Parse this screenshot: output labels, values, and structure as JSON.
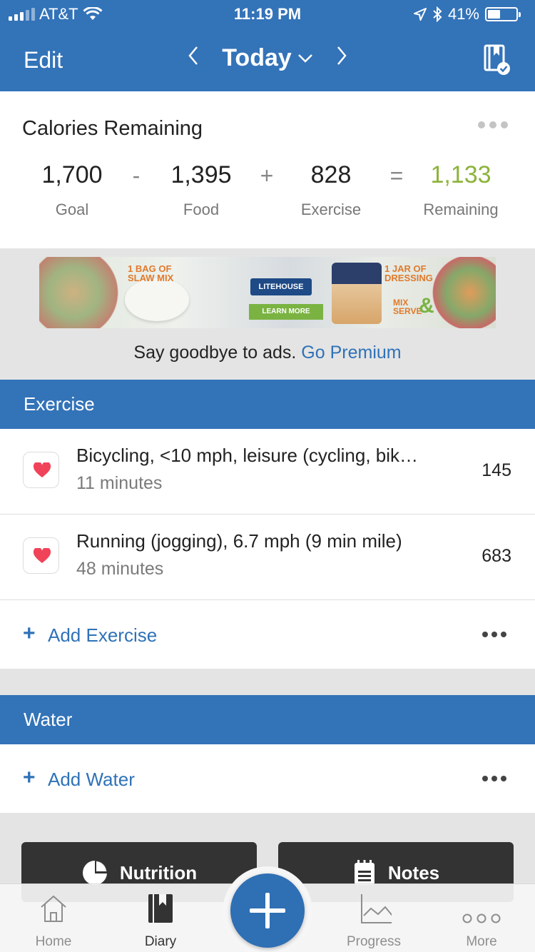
{
  "status_bar": {
    "carrier": "AT&T",
    "time": "11:19 PM",
    "battery": "41%"
  },
  "nav": {
    "edit": "Edit",
    "title": "Today",
    "prev": "<",
    "next": ">"
  },
  "calories": {
    "title": "Calories Remaining",
    "goal": {
      "value": "1,700",
      "label": "Goal"
    },
    "food": {
      "value": "1,395",
      "label": "Food"
    },
    "exercise": {
      "value": "828",
      "label": "Exercise"
    },
    "remaining": {
      "value": "1,133",
      "label": "Remaining"
    },
    "ops": [
      "-",
      "+",
      "="
    ],
    "remaining_color": "#8cb33a"
  },
  "ad": {
    "text1": "1 BAG OF SLAW MIX",
    "brand": "LITEHOUSE",
    "cta": "LEARN MORE",
    "text2": "1 JAR OF DRESSING",
    "text3": "MIX SERVE",
    "amp": "&",
    "premium_text": "Say goodbye to ads.",
    "premium_link": "Go Premium"
  },
  "exercise": {
    "header": "Exercise",
    "items": [
      {
        "name": "Bicycling, <10 mph, leisure (cycling, bik…",
        "duration": "11 minutes",
        "calories": "145"
      },
      {
        "name": "Running (jogging), 6.7 mph (9 min mile)",
        "duration": "48 minutes",
        "calories": "683"
      }
    ],
    "add": "Add Exercise"
  },
  "water": {
    "header": "Water",
    "add": "Add Water"
  },
  "buttons": {
    "nutrition": "Nutrition",
    "notes": "Notes"
  },
  "tabs": [
    {
      "label": "Home",
      "icon": "home-icon"
    },
    {
      "label": "Diary",
      "icon": "diary-icon"
    },
    {
      "label": "Progress",
      "icon": "progress-icon"
    },
    {
      "label": "More",
      "icon": "more-icon"
    }
  ],
  "colors": {
    "brand_blue": "#3373b8",
    "link_blue": "#2f72b8",
    "remaining_green": "#8cb33a"
  }
}
